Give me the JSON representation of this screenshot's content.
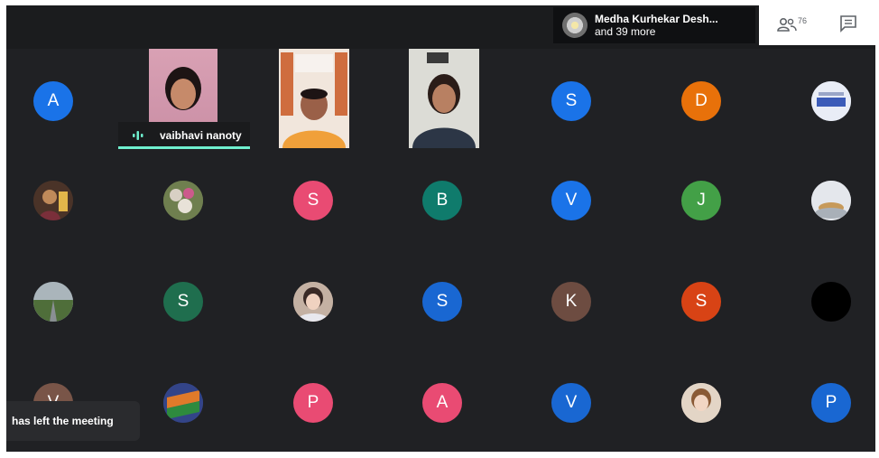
{
  "presenter": {
    "name": "Medha Kurhekar Desh...",
    "more": "and 39 more"
  },
  "toolbar": {
    "people_count": "76",
    "people_icon": "people-icon",
    "chat_icon": "chat-icon"
  },
  "speaking": {
    "name": "vaibhavi nanoty",
    "icon": "audio-level-icon"
  },
  "toast": {
    "text": "has left the meeting"
  },
  "participants": {
    "p1": {
      "initial": "A",
      "color": "#1a73e8"
    },
    "p2": {
      "initial": "S",
      "color": "#1a73e8"
    },
    "p3": {
      "initial": "D",
      "color": "#e8710a"
    },
    "p4": {
      "initial": "S",
      "color": "#e94b73"
    },
    "p5": {
      "initial": "B",
      "color": "#0f7b6c"
    },
    "p6": {
      "initial": "V",
      "color": "#1a73e8"
    },
    "p7": {
      "initial": "J",
      "color": "#43a047"
    },
    "p8": {
      "initial": "S",
      "color": "#1f6e4e"
    },
    "p9": {
      "initial": "S",
      "color": "#1967d2"
    },
    "p10": {
      "initial": "K",
      "color": "#6d4c41"
    },
    "p11": {
      "initial": "S",
      "color": "#d84315"
    },
    "p12": {
      "initial": "V",
      "color": "#795548"
    },
    "p13": {
      "initial": "P",
      "color": "#e94b73"
    },
    "p14": {
      "initial": "A",
      "color": "#e94b73"
    },
    "p15": {
      "initial": "V",
      "color": "#1967d2"
    },
    "p16": {
      "initial": "P",
      "color": "#1967d2"
    }
  }
}
